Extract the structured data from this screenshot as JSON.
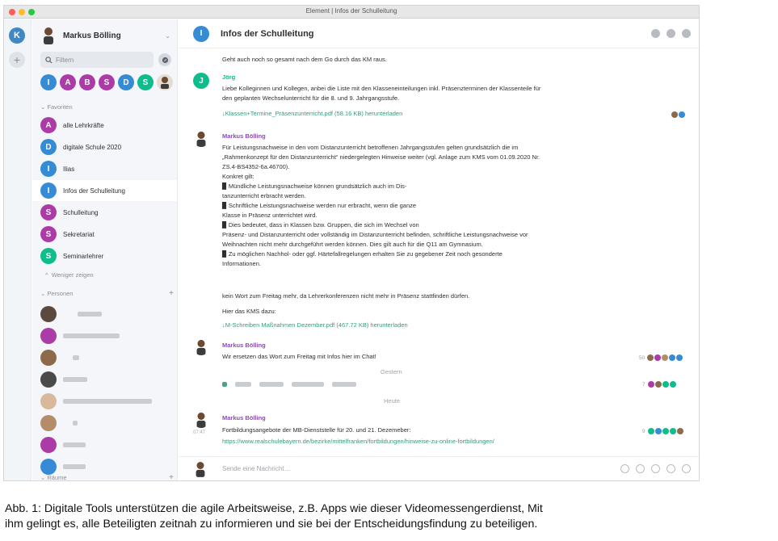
{
  "window": {
    "title": "Element | Infos der Schulleitung",
    "traffic_lights": [
      "#fc5f57",
      "#fdbc2e",
      "#28c840"
    ]
  },
  "space_bar": {
    "home_letter": "K",
    "home_color": "#3f88c5",
    "add_label": "+"
  },
  "sidebar": {
    "user_name": "Markus Bölling",
    "filter_placeholder": "Filtern",
    "recent_bubbles": [
      {
        "letter": "I",
        "color": "#368bd6"
      },
      {
        "letter": "A",
        "color": "#ac3ba8"
      },
      {
        "letter": "B",
        "color": "#ac3ba8"
      },
      {
        "letter": "S",
        "color": "#ac3ba8"
      },
      {
        "letter": "D",
        "color": "#368bd6"
      },
      {
        "letter": "S",
        "color": "#0dbd8b"
      }
    ],
    "favourites_label": "Favoriten",
    "rooms": [
      {
        "letter": "A",
        "name": "alle Lehrkräfte",
        "color": "#ac3ba8"
      },
      {
        "letter": "D",
        "name": "digitale Schule 2020",
        "color": "#368bd6"
      },
      {
        "letter": "I",
        "name": "Ilias",
        "color": "#368bd6"
      },
      {
        "letter": "I",
        "name": "Infos der Schulleitung",
        "color": "#368bd6"
      },
      {
        "letter": "S",
        "name": "Schulleitung",
        "color": "#ac3ba8"
      },
      {
        "letter": "S",
        "name": "Sekretariat",
        "color": "#ac3ba8"
      },
      {
        "letter": "S",
        "name": "Seminarlehrer",
        "color": "#0dbd8b"
      }
    ],
    "show_less_label": "Weniger zeigen",
    "people_label": "Personen",
    "rooms_label": "Räume"
  },
  "room": {
    "title": "Infos der Schulleitung",
    "letter": "I",
    "color": "#368bd6"
  },
  "timeline": {
    "m0_text": "Geht auch noch so gesamt nach dem Go durch das KM raus.",
    "m1_sender": "Jörg",
    "m1_letter": "J",
    "m1_line1": "Liebe Kolleginnen und Kollegen, anbei die Liste mit den Klasseneinteilungen inkl. Präsenzterminen der Klassenteile für",
    "m1_line2": "den geplanten Wechselunterricht für die 8. und 9. Jahrgangsstufe.",
    "m1_file": "↓Klassen+Termine_Präsenzunterricht.pdf (58.16 KB) herunterladen",
    "m2_sender": "Markus Bölling",
    "m2_lines": [
      "Für Leistungsnachweise in den vom Distanzunterricht betroffenen Jahrgangsstufen gelten grundsätzlich die im",
      "„Rahmenkonzept für den Distanzunterricht“ niedergelegten Hinweise weiter (vgl. Anlage zum KMS vom 01.09.2020 Nr.",
      "ZS.4-BS4352-6a.46700).",
      "Konkret gilt:",
      "▉ Mündliche Leistungsnachweise können grundsätzlich auch im Dis-",
      "tanzunterricht erbracht werden.",
      "▉ Schriftliche Leistungsnachweise werden nur erbracht, wenn die ganze",
      "Klasse in Präsenz unterrichtet wird.",
      "▉ Dies bedeutet, dass in Klassen bzw. Gruppen, die sich im Wechsel von",
      "Präsenz- und Distanzunterricht oder vollständig im Distanzunterricht befinden, schriftliche Leistungsnachweise vor",
      "Weihnachten nicht mehr durchgeführt werden können. Dies gilt auch für die Q11 am Gymnasium.",
      "▉ Zu möglichen Nachhol- oder ggf. Härtefallregelungen erhalten Sie zu gegebener Zeit noch gesonderte",
      "Informationen."
    ],
    "m3_text": "kein Wort zum Freitag mehr, da Lehrerkonferenzen nicht mehr in Präsenz stattfinden dürfen.",
    "m4_text": "Hier das KMS dazu:",
    "m4_file": "↓M-Schreiben Maßnahmen Dezember.pdf (467.72 KB) herunterladen",
    "m5_sender": "Markus Bölling",
    "m5_text": "Wir ersetzen das Wort zum Freitag mit Infos hier im Chat!",
    "m5_receipt_count": "50",
    "sep_yesterday": "Gestern",
    "m6_receipt_count": "7",
    "sep_today": "Heute",
    "m7_sender": "Markus Bölling",
    "m7_time": "07:47",
    "m7_text": "Fortbildungsangebote der MB-Dienststelle für 20. und 21. Dezemeber:",
    "m7_link": "https://www.realschulebayern.de/bezirke/mittelfranken/fortbildungen/hinweise-zu-online-fortbildungen/",
    "m7_receipt_count": "9"
  },
  "composer": {
    "placeholder": "Sende eine Nachricht…"
  },
  "caption": {
    "line1": "Abb. 1: Digitale Tools unterstützen die agile Arbeitsweise, z.B. Apps wie dieser Videomessengerdienst, Mit",
    "line2": "ihm gelingt es, alle Beteiligten zeitnah zu informieren und sie bei der Entscheidungsfindung zu beteiligen."
  },
  "colors": {
    "sender_purple": "#8b4bb8",
    "sender_green": "#0dbd8b",
    "link_green": "#3a9a78"
  }
}
